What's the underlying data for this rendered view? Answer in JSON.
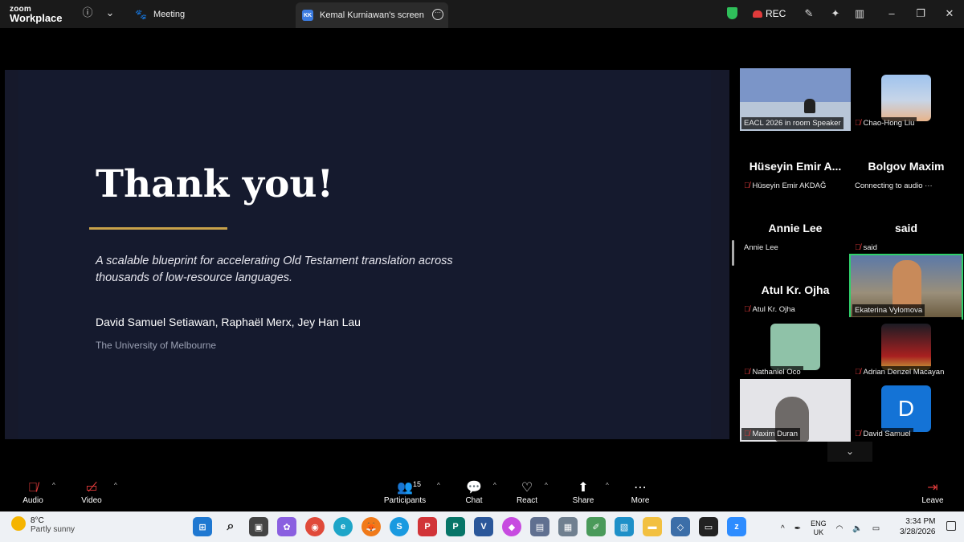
{
  "app": {
    "logo_line1": "zoom",
    "logo_line2": "Workplace",
    "meeting_tab": "Meeting",
    "screen_tab_initials": "KK",
    "screen_tab_label": "Kemal Kurniawan's screen",
    "rec_label": "REC"
  },
  "slide": {
    "title": "Thank you!",
    "subtitle": "A scalable blueprint for accelerating Old Testament translation across thousands of low-resource languages.",
    "authors": "David Samuel Setiawan, Raphaël Merx, Jey Han Lau",
    "affiliation": "The University of Melbourne"
  },
  "gallery": [
    {
      "display": "",
      "name": "EACL 2026 in room Speaker",
      "muted": false,
      "kind": "video"
    },
    {
      "display": "",
      "name": "Chao-Hong Liu",
      "muted": true,
      "kind": "image"
    },
    {
      "display": "Hüseyin  Emir  A...",
      "name": "Hüseyin Emir AKDAĞ",
      "muted": true,
      "kind": "text"
    },
    {
      "display": "Bolgov Maxim",
      "name": "Connecting to audio ···",
      "muted": false,
      "kind": "text"
    },
    {
      "display": "Annie Lee",
      "name": "Annie Lee",
      "muted": false,
      "kind": "text"
    },
    {
      "display": "said",
      "name": "said",
      "muted": true,
      "kind": "text"
    },
    {
      "display": "Atul Kr. Ojha",
      "name": "Atul Kr. Ojha",
      "muted": true,
      "kind": "text"
    },
    {
      "display": "",
      "name": "Ekaterina Vylomova",
      "muted": false,
      "kind": "video"
    },
    {
      "display": "",
      "name": "Nathaniel Oco",
      "muted": true,
      "kind": "image"
    },
    {
      "display": "",
      "name": "Adrian Denzel Macayan",
      "muted": true,
      "kind": "image"
    },
    {
      "display": "",
      "name": "Maxim Duran",
      "muted": true,
      "kind": "video"
    },
    {
      "display": "D",
      "name": "David Samuel",
      "muted": true,
      "kind": "letter"
    }
  ],
  "toolbar": {
    "audio": "Audio",
    "video": "Video",
    "participants": "Participants",
    "participants_count": "15",
    "chat": "Chat",
    "react": "React",
    "share": "Share",
    "more": "More",
    "leave": "Leave"
  },
  "taskbar": {
    "temp": "8°C",
    "weather": "Partly sunny",
    "lang1": "ENG",
    "lang2": "UK",
    "time": "3:34 PM",
    "date": "3/28/2026"
  }
}
